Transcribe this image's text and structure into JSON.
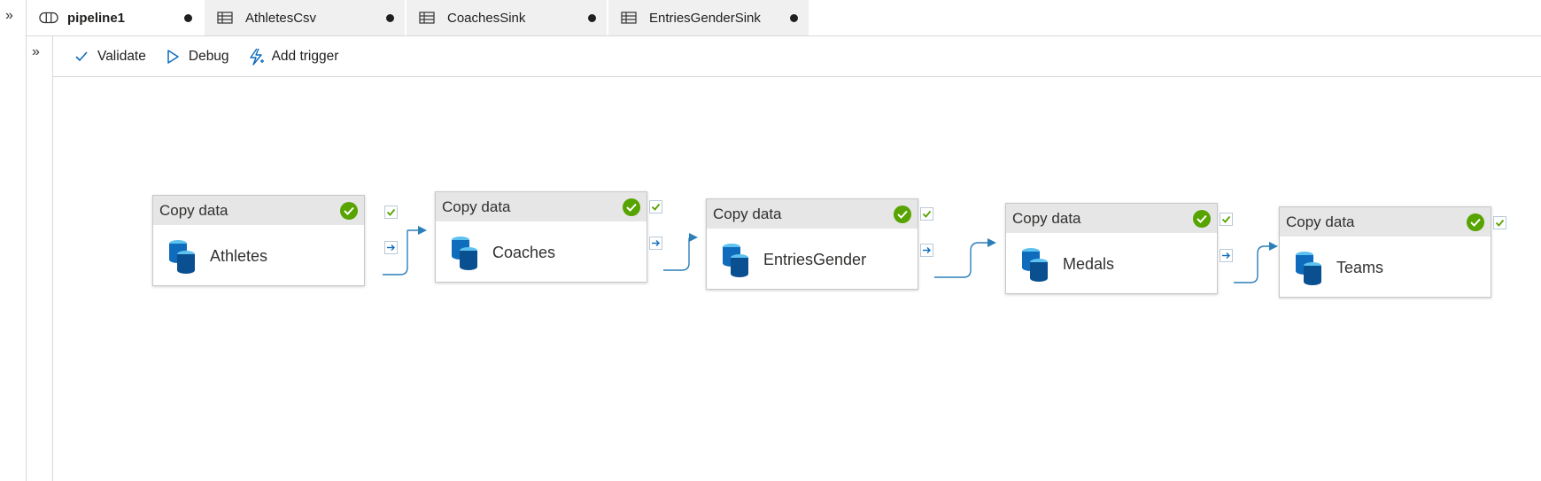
{
  "tabs": [
    {
      "label": "pipeline1",
      "icon": "pipeline-icon",
      "active": true,
      "unsaved": true
    },
    {
      "label": "AthletesCsv",
      "icon": "table-icon",
      "active": false,
      "unsaved": true
    },
    {
      "label": "CoachesSink",
      "icon": "table-icon",
      "active": false,
      "unsaved": true
    },
    {
      "label": "EntriesGenderSink",
      "icon": "table-icon",
      "active": false,
      "unsaved": true
    }
  ],
  "toolbar": {
    "validate_label": "Validate",
    "debug_label": "Debug",
    "add_trigger_label": "Add trigger"
  },
  "activities": [
    {
      "type": "Copy data",
      "name": "Athletes",
      "status": "succeeded"
    },
    {
      "type": "Copy data",
      "name": "Coaches",
      "status": "succeeded"
    },
    {
      "type": "Copy data",
      "name": "EntriesGender",
      "status": "succeeded"
    },
    {
      "type": "Copy data",
      "name": "Medals",
      "status": "succeeded"
    },
    {
      "type": "Copy data",
      "name": "Teams",
      "status": "succeeded"
    }
  ],
  "colors": {
    "success": "#57a300",
    "accent": "#0f6cbd",
    "link": "#2b7fb8"
  }
}
